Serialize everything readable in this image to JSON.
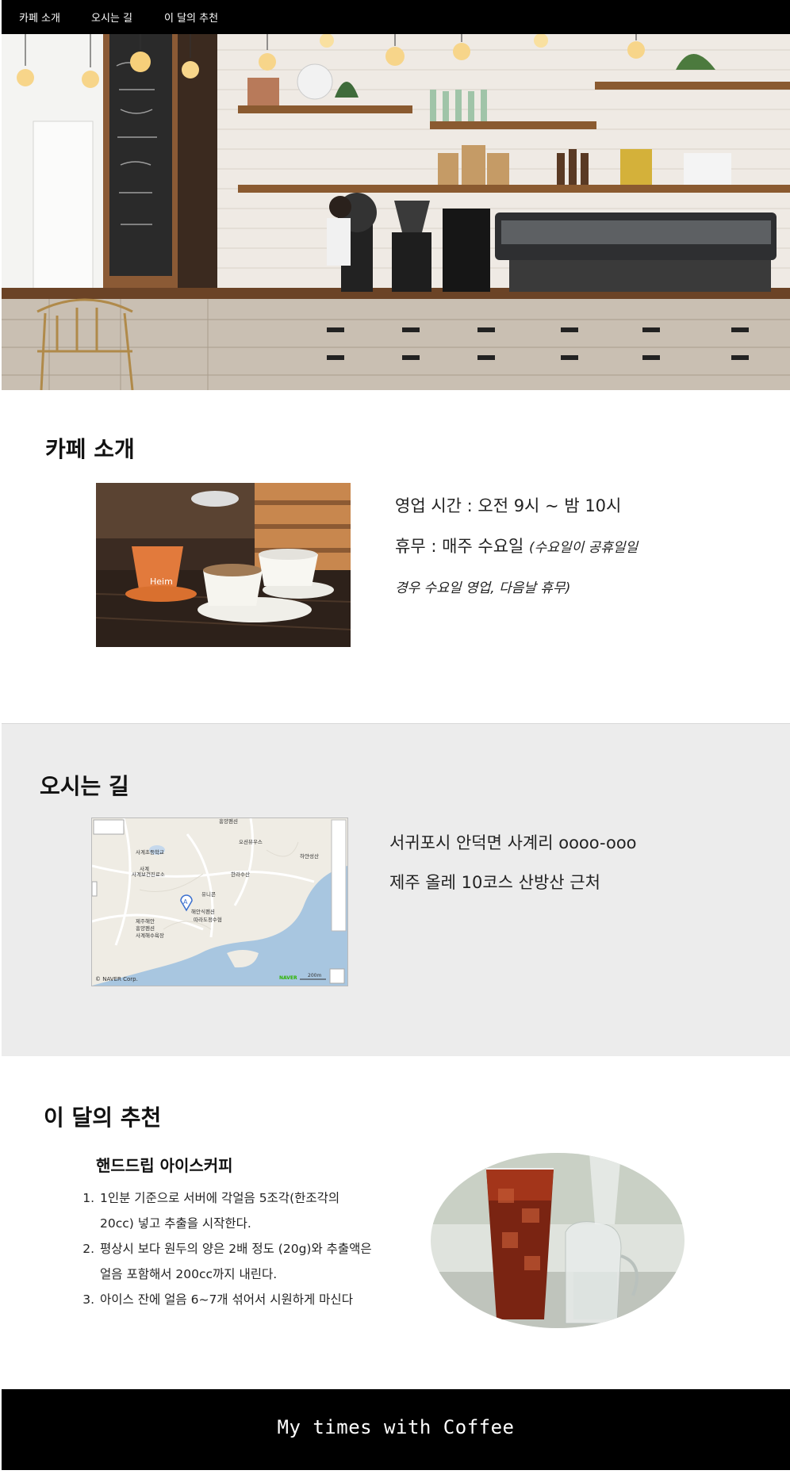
{
  "nav": {
    "items": [
      {
        "label": "카페 소개"
      },
      {
        "label": "오시는 길"
      },
      {
        "label": "이 달의 추천"
      }
    ]
  },
  "intro": {
    "title": "카페 소개",
    "hours": "영업 시간 : 오전 9시 ~ 밤 10시",
    "closed_label": "휴무 : 매주 수요일 ",
    "closed_note_line1": "(수요일이 공휴일일",
    "closed_note_line2": "경우 수요일 영업, 다음날 휴무)"
  },
  "location": {
    "title": "오시는 길",
    "address": "서귀포시 안덕면 사계리 oooo-ooo",
    "landmark": "제주 올레 10코스 산방산 근처",
    "map": {
      "labels": [
        "사계초등학교",
        "사계보건진료소",
        "사계",
        "흥양펜션",
        "오션뷰우스",
        "한라수산",
        "유니콘",
        "해안식펜션",
        "따라도정수협",
        "제주해안",
        "흥양펜션",
        "사계해수욕장",
        "하얀성산"
      ],
      "marker": "A",
      "copyright": "© NAVER Corp.",
      "brand": "NAVER",
      "scale": "200m"
    }
  },
  "recommend": {
    "title": "이 달의 추천",
    "drink_name": "핸드드립 아이스커피",
    "steps": [
      "1인분 기준으로 서버에 각얼음 5조각(한조각의 20cc) 넣고 추출을 시작한다.",
      "평상시 보다 원두의 양은 2배 정도 (20g)와 추출액은 얼음 포함해서 200cc까지 내린다.",
      "아이스 잔에 얼음 6~7개 섞어서 시원하게 마신다"
    ]
  },
  "footer": {
    "title": "My times with Coffee"
  },
  "colors": {
    "nav_bg": "#000000",
    "footer_bg": "#000000",
    "section_alt_bg": "#ececec"
  }
}
